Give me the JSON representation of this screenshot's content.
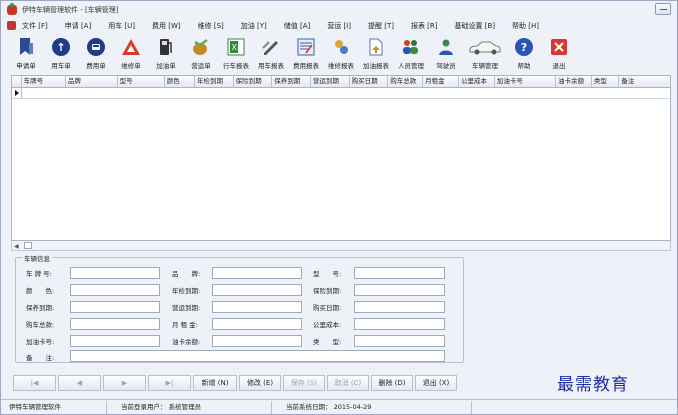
{
  "window": {
    "title": "伊特车辆管理软件 - [车辆管理]"
  },
  "menu": [
    "文件 [F]",
    "申请 [A]",
    "用车 [U]",
    "费用 [W]",
    "维修 [S]",
    "加油 [Y]",
    "储值 [A]",
    "营运 [I]",
    "提醒 [T]",
    "报表 [R]",
    "基础设置 [B]",
    "帮助 [H]"
  ],
  "toolbar": [
    {
      "label": "申请单",
      "icon": "bookmark-icon",
      "color": "#2c4a8c"
    },
    {
      "label": "用车单",
      "icon": "up-arrow-icon",
      "color": "#1f3c8a"
    },
    {
      "label": "费用单",
      "icon": "bus-icon",
      "color": "#1f3c8a"
    },
    {
      "label": "维修单",
      "icon": "warning-triangle-icon",
      "color": "#d63a2a"
    },
    {
      "label": "加油单",
      "icon": "fuel-pump-icon",
      "color": "#333333"
    },
    {
      "label": "营运单",
      "icon": "money-bag-icon",
      "color": "#c48a2a"
    },
    {
      "label": "行车报表",
      "icon": "excel-sheet-icon",
      "color": "#2f8a3a"
    },
    {
      "label": "用车报表",
      "icon": "pen-edit-icon",
      "color": "#444444"
    },
    {
      "label": "费用报表",
      "icon": "report-chart-icon",
      "color": "#3b5fa5"
    },
    {
      "label": "维修报表",
      "icon": "tools-gear-icon",
      "color": "#d6892a"
    },
    {
      "label": "加油报表",
      "icon": "document-arrow-icon",
      "color": "#5577aa"
    },
    {
      "label": "人员管理",
      "icon": "users-group-icon",
      "color": "#2a7a3a"
    },
    {
      "label": "驾驶员",
      "icon": "driver-icon",
      "color": "#3a8a4a"
    },
    {
      "label": "车辆管理",
      "icon": "car-icon",
      "color": "#888888"
    },
    {
      "label": "帮助",
      "icon": "help-icon",
      "color": "#2a55b5"
    },
    {
      "label": "退出",
      "icon": "exit-close-icon",
      "color": "#d63a2a"
    }
  ],
  "grid": {
    "columns": [
      "车牌号",
      "品牌",
      "型号",
      "颜色",
      "年检到期",
      "保险到期",
      "保养到期",
      "营运到期",
      "购买日期",
      "购车总款",
      "月租金",
      "公里成本",
      "加油卡号",
      "油卡余额",
      "类型",
      "备注"
    ]
  },
  "form": {
    "legend": "车辆信息",
    "fields": [
      {
        "label": "车 牌 号:"
      },
      {
        "label": "品　　牌:"
      },
      {
        "label": "型　　号:"
      },
      {
        "label": "颜　　色:"
      },
      {
        "label": "年检到期:"
      },
      {
        "label": "保险到期:"
      },
      {
        "label": "保养到期:"
      },
      {
        "label": "营运到期:"
      },
      {
        "label": "购买日期:"
      },
      {
        "label": "购车总款:"
      },
      {
        "label": "月 租 金:"
      },
      {
        "label": "公里成本:"
      },
      {
        "label": "加油卡号:"
      },
      {
        "label": "油卡余额:"
      },
      {
        "label": "类　　型:"
      },
      {
        "label": "备　　注:"
      }
    ]
  },
  "nav": {
    "first": "|◀",
    "prev": "◀",
    "next": "▶",
    "last": "▶|",
    "add": "新增 (N)",
    "edit": "修改 (E)",
    "save": "保存 (S)",
    "cancel": "取消 (C)",
    "delete": "删除 (D)",
    "exit": "退出 (X)"
  },
  "watermark": "最需教育",
  "status": {
    "app": "伊特车辆管理软件",
    "user": "当前登录用户：  系统管理员",
    "date": "当前系统日期：  2015-04-29"
  }
}
